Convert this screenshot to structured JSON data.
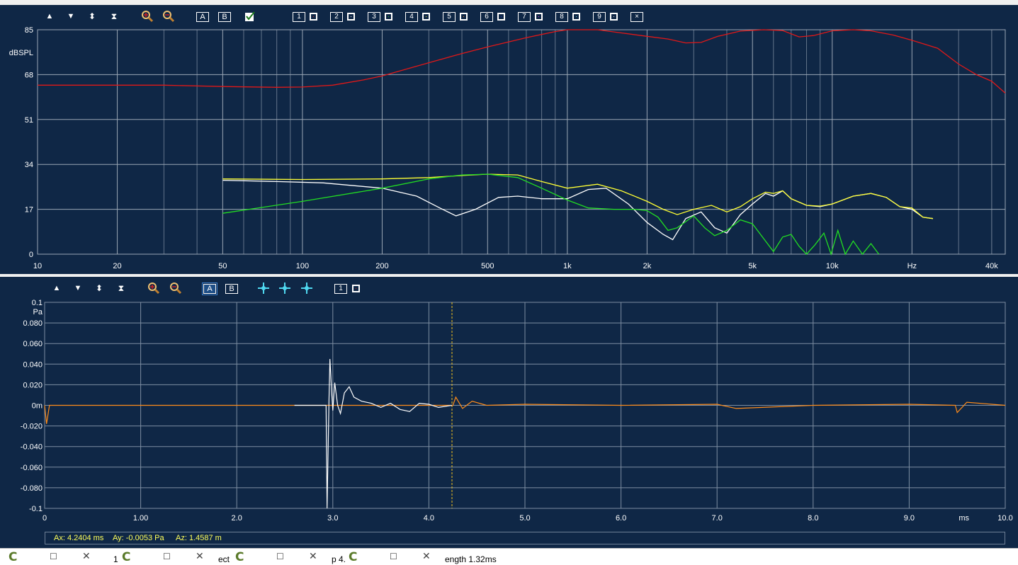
{
  "top_toolbar": {
    "items": [
      "▲",
      "▼",
      "⬍",
      "⧗",
      "zoom-in",
      "zoom-out",
      "A",
      "B",
      "check",
      "1",
      "2",
      "3",
      "4",
      "5",
      "6",
      "7",
      "8",
      "9",
      "×"
    ],
    "swatches": [
      {
        "n": "1",
        "color": "#e02020"
      },
      {
        "n": "2",
        "color": "#ffffff"
      },
      {
        "n": "3",
        "color": "#22dd22"
      },
      {
        "n": "4",
        "color": "#ffff33"
      },
      {
        "n": "5",
        "color": "#ff8c1a"
      },
      {
        "n": "6",
        "color": "#1a2fd0"
      },
      {
        "n": "7",
        "color": "#ee33ee"
      },
      {
        "n": "8",
        "color": "#66e0e8"
      },
      {
        "n": "9",
        "color": "#d8d8d8"
      }
    ],
    "close_label": "×"
  },
  "bottom_toolbar": {
    "a_label": "A",
    "b_label": "B",
    "trace_num": "1",
    "trace_color": "#e02020"
  },
  "chart_data": [
    {
      "type": "line",
      "title": "",
      "ylabel": "dBSPL",
      "xlabel": "Hz",
      "x_scale": "log",
      "xlim": [
        10,
        45000
      ],
      "ylim": [
        0,
        85
      ],
      "y_ticks": [
        "0",
        "17",
        "34",
        "51",
        "68",
        "85"
      ],
      "x_ticks": [
        {
          "v": 10,
          "t": "10"
        },
        {
          "v": 20,
          "t": "20"
        },
        {
          "v": 50,
          "t": "50"
        },
        {
          "v": 100,
          "t": "100"
        },
        {
          "v": 200,
          "t": "200"
        },
        {
          "v": 500,
          "t": "500"
        },
        {
          "v": 1000,
          "t": "1k"
        },
        {
          "v": 2000,
          "t": "2k"
        },
        {
          "v": 5000,
          "t": "5k"
        },
        {
          "v": 10000,
          "t": "10k"
        },
        {
          "v": 20000,
          "t": "Hz"
        },
        {
          "v": 40000,
          "t": "40k"
        }
      ],
      "grid": true,
      "series": [
        {
          "color": "#e01818",
          "points": [
            [
              10,
              64
            ],
            [
              20,
              64
            ],
            [
              30,
              64
            ],
            [
              50,
              63.5
            ],
            [
              80,
              63.2
            ],
            [
              100,
              63.3
            ],
            [
              130,
              64
            ],
            [
              170,
              66
            ],
            [
              200,
              67.5
            ],
            [
              300,
              72.5
            ],
            [
              400,
              76
            ],
            [
              500,
              78.5
            ],
            [
              700,
              82
            ],
            [
              900,
              84.3
            ],
            [
              1000,
              85
            ],
            [
              1300,
              85
            ],
            [
              1600,
              83.8
            ],
            [
              2000,
              82.5
            ],
            [
              2400,
              81.5
            ],
            [
              2800,
              80
            ],
            [
              3200,
              80.2
            ],
            [
              3700,
              82.5
            ],
            [
              4500,
              84.5
            ],
            [
              5500,
              85
            ],
            [
              6500,
              84.7
            ],
            [
              7500,
              82.3
            ],
            [
              8500,
              82.8
            ],
            [
              10000,
              84.6
            ],
            [
              12000,
              85
            ],
            [
              14000,
              84.6
            ],
            [
              17000,
              83
            ],
            [
              20000,
              81
            ],
            [
              25000,
              78
            ],
            [
              30000,
              72
            ],
            [
              35000,
              68
            ],
            [
              40000,
              65.5
            ],
            [
              45000,
              61
            ]
          ]
        },
        {
          "color": "#ffffff",
          "points": [
            [
              50,
              28
            ],
            [
              80,
              27.5
            ],
            [
              120,
              27
            ],
            [
              200,
              25
            ],
            [
              270,
              22
            ],
            [
              330,
              17.5
            ],
            [
              380,
              14.5
            ],
            [
              450,
              17
            ],
            [
              550,
              21.5
            ],
            [
              650,
              22
            ],
            [
              800,
              21
            ],
            [
              1000,
              21
            ],
            [
              1200,
              24.5
            ],
            [
              1400,
              25
            ],
            [
              1700,
              19
            ],
            [
              2000,
              12
            ],
            [
              2300,
              7.5
            ],
            [
              2500,
              5.5
            ],
            [
              2800,
              13.5
            ],
            [
              3200,
              16
            ],
            [
              3600,
              10
            ],
            [
              4000,
              8
            ],
            [
              4500,
              15
            ],
            [
              5000,
              19
            ],
            [
              5600,
              23
            ],
            [
              6000,
              22
            ],
            [
              6500,
              24
            ],
            [
              7000,
              21
            ],
            [
              8000,
              18.5
            ],
            [
              9000,
              18
            ],
            [
              10000,
              19
            ],
            [
              12000,
              22
            ],
            [
              14000,
              23
            ],
            [
              16000,
              21.5
            ],
            [
              18000,
              18
            ],
            [
              20000,
              17
            ],
            [
              22000,
              14
            ],
            [
              24000,
              13.5
            ]
          ]
        },
        {
          "color": "#ffff33",
          "points": [
            [
              50,
              28.5
            ],
            [
              100,
              28.3
            ],
            [
              200,
              28.5
            ],
            [
              300,
              29
            ],
            [
              400,
              29.8
            ],
            [
              500,
              30.3
            ],
            [
              650,
              30
            ],
            [
              800,
              27.5
            ],
            [
              1000,
              25
            ],
            [
              1300,
              26.5
            ],
            [
              1600,
              24
            ],
            [
              2000,
              20
            ],
            [
              2300,
              17
            ],
            [
              2600,
              15
            ],
            [
              3000,
              17
            ],
            [
              3500,
              18.5
            ],
            [
              4000,
              16
            ],
            [
              4500,
              18
            ],
            [
              5000,
              21
            ],
            [
              5600,
              23.5
            ],
            [
              6000,
              23
            ],
            [
              6500,
              24
            ],
            [
              7000,
              21
            ],
            [
              8000,
              18.5
            ],
            [
              9000,
              18.2
            ],
            [
              10000,
              19
            ],
            [
              12000,
              22
            ],
            [
              14000,
              23
            ],
            [
              16000,
              21.5
            ],
            [
              18000,
              18
            ],
            [
              20000,
              17.5
            ],
            [
              22000,
              14
            ],
            [
              24000,
              13.5
            ]
          ]
        },
        {
          "color": "#22dd22",
          "points": [
            [
              50,
              15.5
            ],
            [
              100,
              20
            ],
            [
              200,
              25
            ],
            [
              300,
              28.5
            ],
            [
              400,
              30
            ],
            [
              500,
              30.3
            ],
            [
              650,
              29
            ],
            [
              800,
              25
            ],
            [
              1000,
              20.5
            ],
            [
              1200,
              17.5
            ],
            [
              1500,
              17
            ],
            [
              1800,
              17
            ],
            [
              2000,
              16.5
            ],
            [
              2200,
              14
            ],
            [
              2400,
              9
            ],
            [
              2600,
              10
            ],
            [
              3000,
              14.5
            ],
            [
              3300,
              10
            ],
            [
              3600,
              7
            ],
            [
              4000,
              9
            ],
            [
              4500,
              13
            ],
            [
              5000,
              11.5
            ],
            [
              5500,
              6
            ],
            [
              6000,
              1
            ],
            [
              6500,
              6.5
            ],
            [
              7000,
              7.5
            ],
            [
              7500,
              3
            ],
            [
              8000,
              0
            ],
            [
              8600,
              3.5
            ],
            [
              9300,
              8
            ],
            [
              9900,
              0
            ],
            [
              10500,
              9
            ],
            [
              11200,
              0
            ],
            [
              12000,
              5
            ],
            [
              13000,
              0
            ],
            [
              14000,
              4
            ],
            [
              15000,
              0
            ]
          ]
        }
      ]
    },
    {
      "type": "line",
      "title": "",
      "ylabel": "Pa",
      "xlabel": "ms",
      "xlim": [
        0,
        10
      ],
      "ylim": [
        -0.1,
        0.1
      ],
      "y_ticks": [
        "0.1",
        "0.080",
        "0.060",
        "0.040",
        "0.020",
        "0m",
        "-0.020",
        "-0.040",
        "-0.060",
        "-0.080",
        "-0.1"
      ],
      "x_ticks": [
        {
          "v": 0,
          "t": "0"
        },
        {
          "v": 1,
          "t": "1.00"
        },
        {
          "v": 2,
          "t": "2.0"
        },
        {
          "v": 3,
          "t": "3.0"
        },
        {
          "v": 4,
          "t": "4.0"
        },
        {
          "v": 5,
          "t": "5.0"
        },
        {
          "v": 6,
          "t": "6.0"
        },
        {
          "v": 7,
          "t": "7.0"
        },
        {
          "v": 8,
          "t": "8.0"
        },
        {
          "v": 9,
          "t": "9.0"
        },
        {
          "v": 10,
          "t": "10.0"
        }
      ],
      "cursor_x": 4.2404,
      "grid": true,
      "series": [
        {
          "color": "#ff8c1a",
          "points": [
            [
              0,
              0
            ],
            [
              0.02,
              -0.018
            ],
            [
              0.05,
              0
            ],
            [
              0.4,
              0
            ],
            [
              1,
              0
            ],
            [
              2,
              0
            ],
            [
              2.6,
              0
            ],
            [
              2.93,
              0
            ],
            [
              4.25,
              0
            ],
            [
              4.28,
              0.008
            ],
            [
              4.35,
              -0.003
            ],
            [
              4.45,
              0.004
            ],
            [
              4.6,
              0
            ],
            [
              5,
              0.001
            ],
            [
              6,
              0
            ],
            [
              7,
              0.001
            ],
            [
              7.2,
              -0.003
            ],
            [
              8,
              0
            ],
            [
              9,
              0.001
            ],
            [
              9.48,
              0
            ],
            [
              9.5,
              -0.007
            ],
            [
              9.6,
              0.003
            ],
            [
              10,
              0
            ]
          ]
        },
        {
          "color": "#ffffff",
          "points": [
            [
              2.6,
              0
            ],
            [
              2.93,
              0
            ],
            [
              2.94,
              -0.1
            ],
            [
              2.96,
              0.005
            ],
            [
              2.97,
              0.045
            ],
            [
              2.99,
              0.01
            ],
            [
              3.0,
              -0.005
            ],
            [
              3.02,
              0.022
            ],
            [
              3.05,
              0
            ],
            [
              3.08,
              -0.008
            ],
            [
              3.12,
              0.012
            ],
            [
              3.17,
              0.018
            ],
            [
              3.22,
              0.008
            ],
            [
              3.3,
              0.004
            ],
            [
              3.4,
              0.002
            ],
            [
              3.5,
              -0.002
            ],
            [
              3.6,
              0.002
            ],
            [
              3.7,
              -0.004
            ],
            [
              3.8,
              -0.006
            ],
            [
              3.9,
              0.002
            ],
            [
              4.0,
              0.001
            ],
            [
              4.1,
              -0.002
            ],
            [
              4.24,
              0
            ]
          ]
        }
      ]
    }
  ],
  "cursor_readout": {
    "ax": "Ax: 4.2404 ms",
    "ay": "Ay: -0.0053 Pa",
    "az": "Az: 1.4587 m"
  },
  "taskbar": {
    "items": [
      {
        "c": "C"
      },
      {
        "c": "C"
      },
      {
        "c": "C"
      },
      {
        "c": "C"
      }
    ],
    "fragments": [
      "1",
      "ect",
      "p 4.",
      "ength 1.32ms"
    ]
  }
}
